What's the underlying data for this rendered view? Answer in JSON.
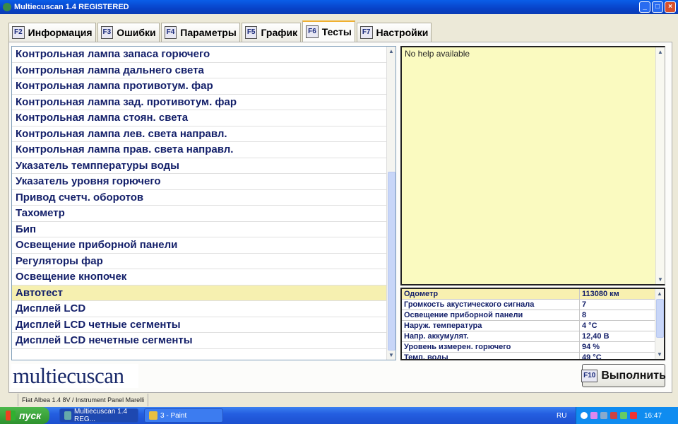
{
  "window": {
    "title": "Multiecuscan 1.4 REGISTERED"
  },
  "tabs": [
    {
      "key": "F2",
      "label": "Информация"
    },
    {
      "key": "F3",
      "label": "Ошибки"
    },
    {
      "key": "F4",
      "label": "Параметры"
    },
    {
      "key": "F5",
      "label": "График"
    },
    {
      "key": "F6",
      "label": "Тесты",
      "active": true
    },
    {
      "key": "F7",
      "label": "Настройки"
    }
  ],
  "tests": [
    "Контрольная лампа запаса горючего",
    "Контрольная лампа дальнего света",
    "Контрольная лампа противотум. фар",
    "Контрольная лампа зад. противотум. фар",
    "Контрольная лампа стоян. света",
    "Контрольная лампа лев. света направл.",
    "Контрольная лампа прав. света направл.",
    "Указатель темппературы воды",
    "Указатель уровня горючего",
    "Привод счетч. оборотов",
    "Тахометр",
    "Бип",
    "Освещение приборной панели",
    "Регуляторы фар",
    "Освещение кнопочек",
    "Автотест",
    "Дисплей LCD",
    "Дисплей LCD четные сегменты",
    "Дисплей LCD нечетные сегменты"
  ],
  "selected_test_index": 15,
  "help": {
    "text": "No help available"
  },
  "params": [
    {
      "name": "Одометр",
      "value": "113080 км"
    },
    {
      "name": "Громкость акустического сигнала",
      "value": "7"
    },
    {
      "name": "Освещение приборной панели",
      "value": "8"
    },
    {
      "name": "Наруж. температура",
      "value": "4 °C"
    },
    {
      "name": "Напр. аккумулят.",
      "value": "12,40 В"
    },
    {
      "name": "Уровень измерен. горючего",
      "value": "94 %"
    },
    {
      "name": "Темп. воды",
      "value": "49 °C"
    }
  ],
  "logo": "multiecuscan",
  "execute": {
    "key": "F10",
    "label": "Выполнить"
  },
  "status": {
    "vehicle": "Fiat Albea 1.4 8V / Instrument Panel Marelli"
  },
  "taskbar": {
    "start": "пуск",
    "tasks": [
      "Multiecuscan 1.4 REG...",
      "3 - Paint"
    ],
    "lang": "RU",
    "clock": "16:47"
  }
}
